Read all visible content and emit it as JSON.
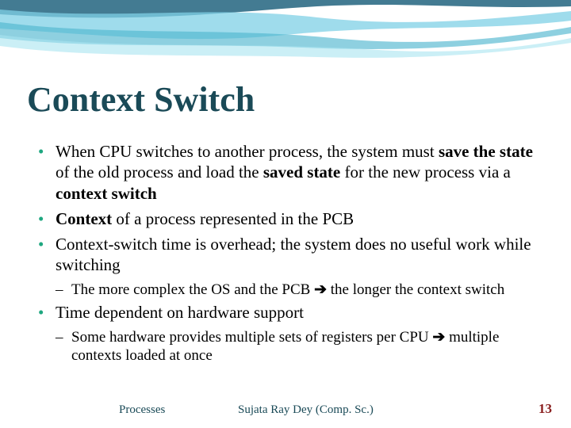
{
  "title": "Context Switch",
  "bullets": [
    {
      "level": 1,
      "segments": [
        {
          "t": "When CPU switches to another process, the system must "
        },
        {
          "t": "save the state",
          "b": true
        },
        {
          "t": " of the old process and load the "
        },
        {
          "t": "saved state",
          "b": true
        },
        {
          "t": " for the new process via a "
        },
        {
          "t": "context switch",
          "b": true
        }
      ]
    },
    {
      "level": 1,
      "segments": [
        {
          "t": "Context",
          "b": true
        },
        {
          "t": " of a process represented in the PCB"
        }
      ]
    },
    {
      "level": 1,
      "segments": [
        {
          "t": "Context-switch time is overhead; the system does no useful work while switching"
        }
      ]
    },
    {
      "level": 2,
      "segments": [
        {
          "t": "The more complex the OS and the PCB "
        },
        {
          "t": "➔",
          "arrow": true
        },
        {
          "t": " the longer the context switch"
        }
      ]
    },
    {
      "level": 1,
      "segments": [
        {
          "t": "Time dependent on hardware support"
        }
      ]
    },
    {
      "level": 2,
      "segments": [
        {
          "t": "Some hardware provides multiple sets of registers per CPU "
        },
        {
          "t": "➔",
          "arrow": true
        },
        {
          "t": " multiple contexts loaded at once"
        }
      ]
    }
  ],
  "footer": {
    "left": "Processes",
    "center": "Sujata Ray Dey (Comp. Sc.)",
    "page": "13"
  }
}
